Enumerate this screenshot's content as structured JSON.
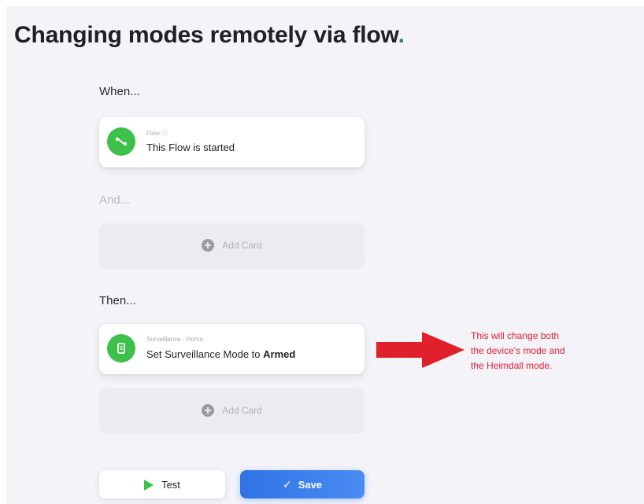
{
  "title": "Changing modes remotely via flow",
  "title_punctuation": ".",
  "colors": {
    "accent_green": "#3cc14a",
    "save_blue": "#2f73e6",
    "annotation_red": "#e0203a"
  },
  "when": {
    "label": "When...",
    "card": {
      "icon": "flow-icon",
      "sub": "Flow ⓘ",
      "main": "This Flow is started"
    }
  },
  "and": {
    "label": "And...",
    "add_card": "Add Card"
  },
  "then": {
    "label": "Then...",
    "card": {
      "icon": "surveillance-icon",
      "sub": "Surveillance - Home",
      "main_prefix": "Set Surveillance Mode to ",
      "main_value": "Armed"
    },
    "add_card": "Add Card"
  },
  "annotation": {
    "line1": "This will change both",
    "line2": "the device's mode and",
    "line3": "the Heimdall mode."
  },
  "buttons": {
    "test": "Test",
    "save": "Save"
  }
}
